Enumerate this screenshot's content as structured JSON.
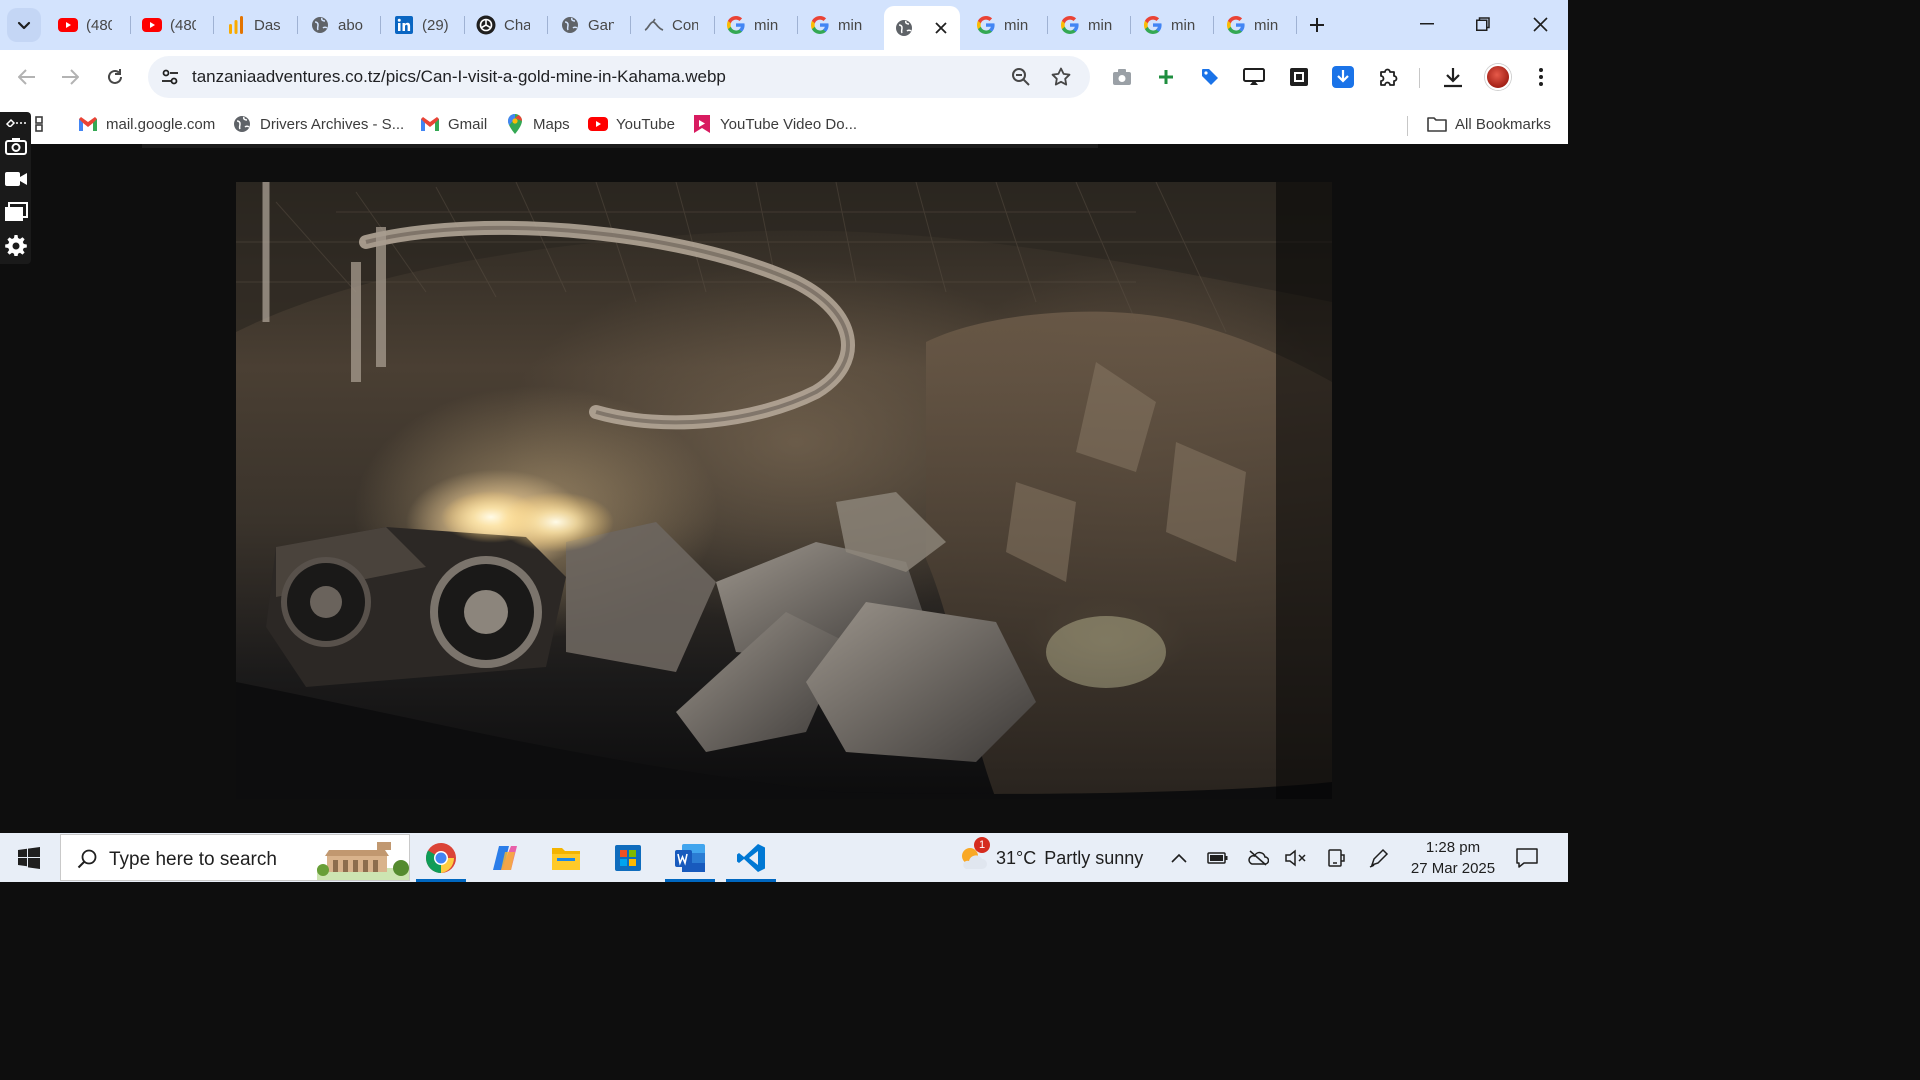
{
  "browser": {
    "tabs": [
      {
        "title": "(480",
        "icon": "youtube-icon"
      },
      {
        "title": "(480",
        "icon": "youtube-icon"
      },
      {
        "title": "Dasl",
        "icon": "analytics-icon"
      },
      {
        "title": "abo",
        "icon": "globe-icon"
      },
      {
        "title": "(29)",
        "icon": "linkedin-icon"
      },
      {
        "title": "Cha",
        "icon": "chatgpt-icon"
      },
      {
        "title": "Gan",
        "icon": "globe-icon"
      },
      {
        "title": "Con",
        "icon": "site-icon"
      },
      {
        "title": "min",
        "icon": "google-icon"
      },
      {
        "title": "min",
        "icon": "google-icon"
      },
      {
        "title": "",
        "icon": "globe-icon",
        "active": true
      },
      {
        "title": "min",
        "icon": "google-icon"
      },
      {
        "title": "min",
        "icon": "google-icon"
      },
      {
        "title": "min",
        "icon": "google-icon"
      },
      {
        "title": "min",
        "icon": "google-icon"
      }
    ],
    "url": "tanzaniaadventures.co.tz/pics/Can-I-visit-a-gold-mine-in-Kahama.webp",
    "bookmarks": [
      {
        "label": "mail.google.com",
        "icon": "gmail-icon"
      },
      {
        "label": "Drivers Archives - S...",
        "icon": "globe-icon"
      },
      {
        "label": "Gmail",
        "icon": "gmail-icon"
      },
      {
        "label": "Maps",
        "icon": "maps-icon"
      },
      {
        "label": "YouTube",
        "icon": "youtube-icon"
      },
      {
        "label": "YouTube Video Do...",
        "icon": "bookmark-app-icon"
      }
    ],
    "all_bookmarks": "All Bookmarks"
  },
  "page": {
    "image_subject": "underground gold mine tunnel with loader"
  },
  "taskbar": {
    "search_placeholder": "Type here to search",
    "apps": [
      "chrome",
      "copilot",
      "file-explorer",
      "microsoft-store",
      "word",
      "vscode"
    ],
    "weather": {
      "temp": "31°C",
      "condition": "Partly sunny",
      "badge": "1"
    },
    "time": "1:28 pm",
    "date": "27 Mar 2025"
  },
  "colors": {
    "tabstrip": "#d3e3fd",
    "taskbar": "#e8eef7",
    "accent": "#0067c0",
    "youtube": "#ff0000"
  }
}
